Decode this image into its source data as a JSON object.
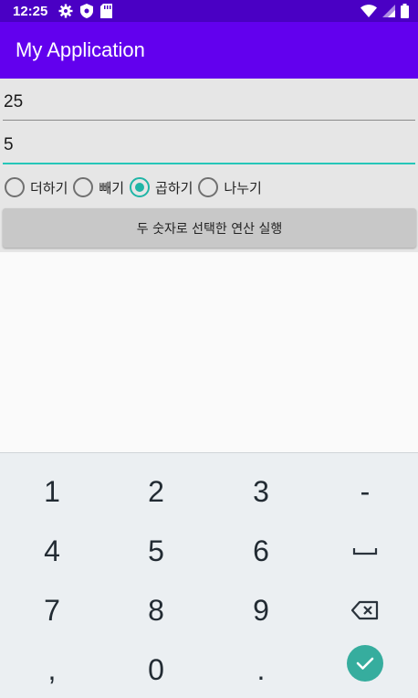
{
  "status_bar": {
    "time": "12:25",
    "left_icons": [
      "settings-gear-icon",
      "shield-icon",
      "sd-card-icon"
    ],
    "right_icons": [
      "wifi-icon",
      "signal-icon",
      "battery-icon"
    ]
  },
  "app_bar": {
    "title": "My Application"
  },
  "form": {
    "number1": {
      "value": "25"
    },
    "number2": {
      "value": "5"
    },
    "operations": [
      {
        "label": "더하기",
        "checked": false
      },
      {
        "label": "빼기",
        "checked": false
      },
      {
        "label": "곱하기",
        "checked": true
      },
      {
        "label": "나누기",
        "checked": false
      }
    ],
    "execute_button": "두 숫자로 선택한 연산 실행"
  },
  "keyboard": {
    "rows": [
      [
        "1",
        "2",
        "3",
        "-"
      ],
      [
        "4",
        "5",
        "6",
        "space"
      ],
      [
        "7",
        "8",
        "9",
        "backspace"
      ],
      [
        ",",
        "0",
        ".",
        "done"
      ]
    ],
    "colors": {
      "background": "#ebeff2",
      "done_key": "#36ad9e",
      "accent": "#1fb5a6",
      "app_bar": "#6200ee",
      "status_bar": "#4a00c4"
    }
  }
}
